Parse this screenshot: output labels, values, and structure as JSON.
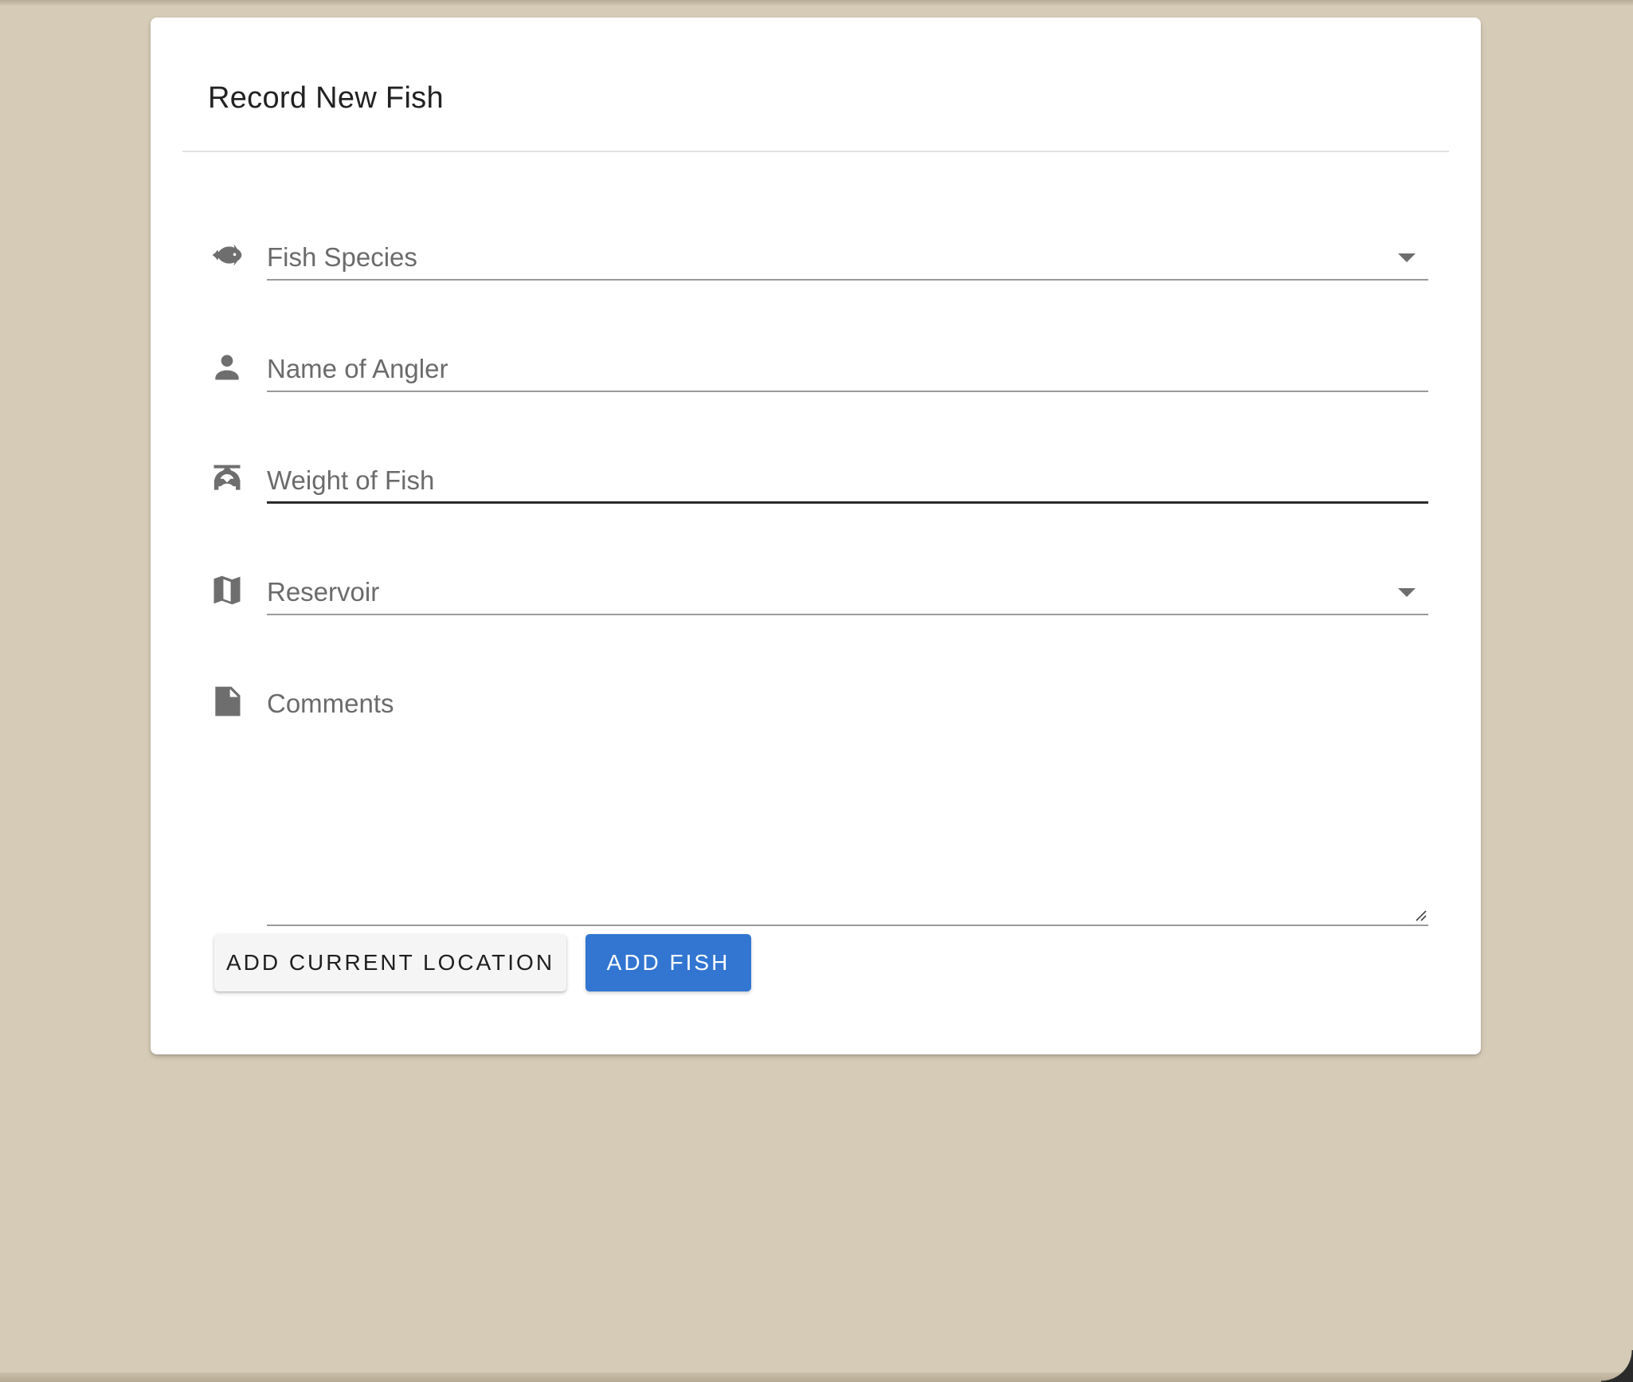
{
  "form": {
    "title": "Record New Fish",
    "fields": {
      "species": {
        "label": "Fish Species",
        "icon": "fish-icon",
        "type": "select"
      },
      "angler": {
        "label": "Name of Angler",
        "icon": "person-icon",
        "type": "text"
      },
      "weight": {
        "label": "Weight of Fish",
        "icon": "scale-icon",
        "type": "text"
      },
      "reservoir": {
        "label": "Reservoir",
        "icon": "map-icon",
        "type": "select"
      },
      "comments": {
        "label": "Comments",
        "icon": "note-icon",
        "type": "textarea"
      }
    },
    "buttons": {
      "location_label": "ADD CURRENT LOCATION",
      "submit_label": "ADD FISH"
    }
  },
  "colors": {
    "background": "#d6cbb6",
    "card": "#ffffff",
    "primary_button": "#3276d2",
    "icon_gray": "#6e6e6e"
  }
}
